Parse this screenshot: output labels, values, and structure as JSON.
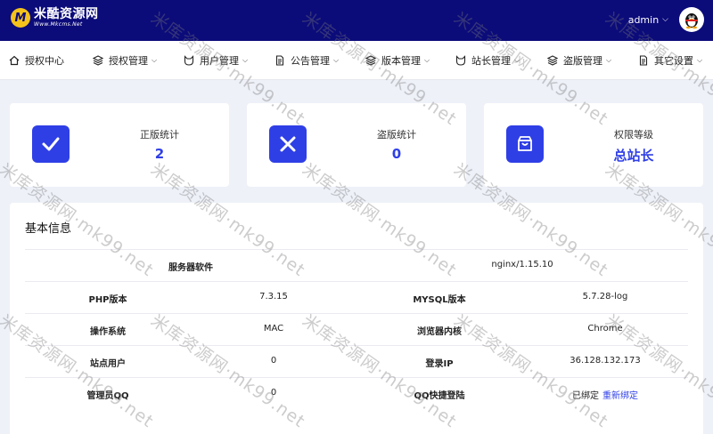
{
  "brand": {
    "title": "米酷资源网",
    "subtitle": "Www.Mkcms.Net"
  },
  "user": {
    "name": "admin",
    "caret": "⌵"
  },
  "nav": [
    {
      "label": "授权中心",
      "icon": "home-icon",
      "has_caret": false
    },
    {
      "label": "授权管理",
      "icon": "layers-icon",
      "has_caret": true
    },
    {
      "label": "用户管理",
      "icon": "user-fox-icon",
      "has_caret": true
    },
    {
      "label": "公告管理",
      "icon": "document-icon",
      "has_caret": true
    },
    {
      "label": "版本管理",
      "icon": "layers-icon",
      "has_caret": true
    },
    {
      "label": "站长管理",
      "icon": "user-fox-icon",
      "has_caret": true
    },
    {
      "label": "盗版管理",
      "icon": "layers-icon",
      "has_caret": true
    },
    {
      "label": "其它设置",
      "icon": "document-icon",
      "has_caret": true
    }
  ],
  "stats": [
    {
      "label": "正版统计",
      "value": "2",
      "icon": "check-icon"
    },
    {
      "label": "盗版统计",
      "value": "0",
      "icon": "x-icon"
    },
    {
      "label": "权限等级",
      "value": "总站长",
      "icon": "shopping-bag-icon"
    }
  ],
  "info": {
    "title": "基本信息",
    "server_label": "服务器软件",
    "server_value": "nginx/1.15.10",
    "rows": [
      {
        "l1": "PHP版本",
        "v1": "7.3.15",
        "l2": "MYSQL版本",
        "v2": "5.7.28-log"
      },
      {
        "l1": "操作系统",
        "v1": "MAC",
        "l2": "浏览器内核",
        "v2": "Chrome"
      },
      {
        "l1": "站点用户",
        "v1": "0",
        "l2": "登录IP",
        "v2": "36.128.132.173"
      },
      {
        "l1": "管理员QQ",
        "v1": "0",
        "l2": "QQ快捷登陆",
        "v2": "已绑定",
        "link": "重新绑定"
      }
    ]
  },
  "watermark": "米库资源网·mk99.net",
  "colors": {
    "topbar": "#0b0b7a",
    "accent": "#2f3fe6",
    "background": "#eef1f8"
  }
}
